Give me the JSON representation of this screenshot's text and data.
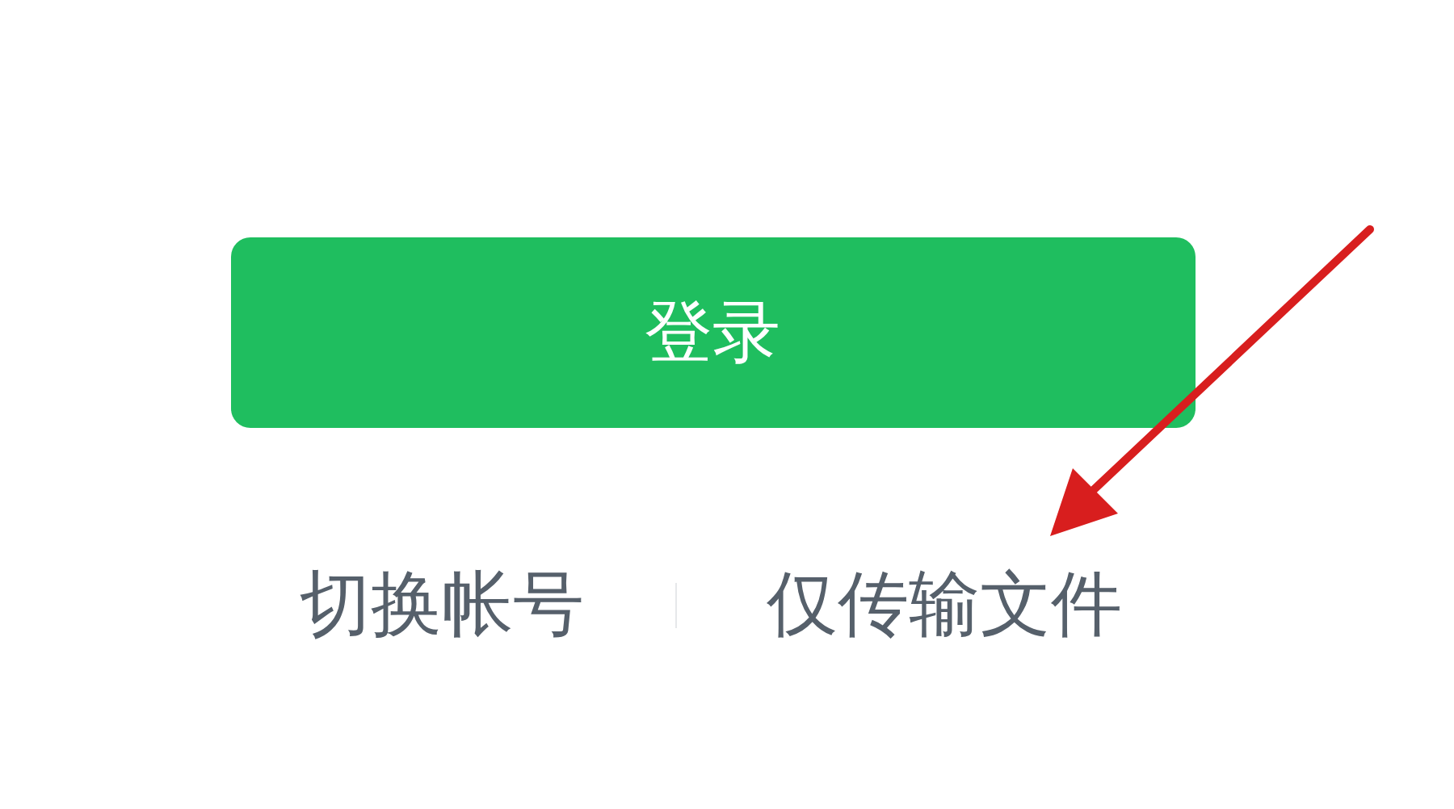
{
  "login_button": {
    "label": "登录"
  },
  "links": [
    {
      "label": "切换帐号"
    },
    {
      "label": "仅传输文件"
    }
  ]
}
